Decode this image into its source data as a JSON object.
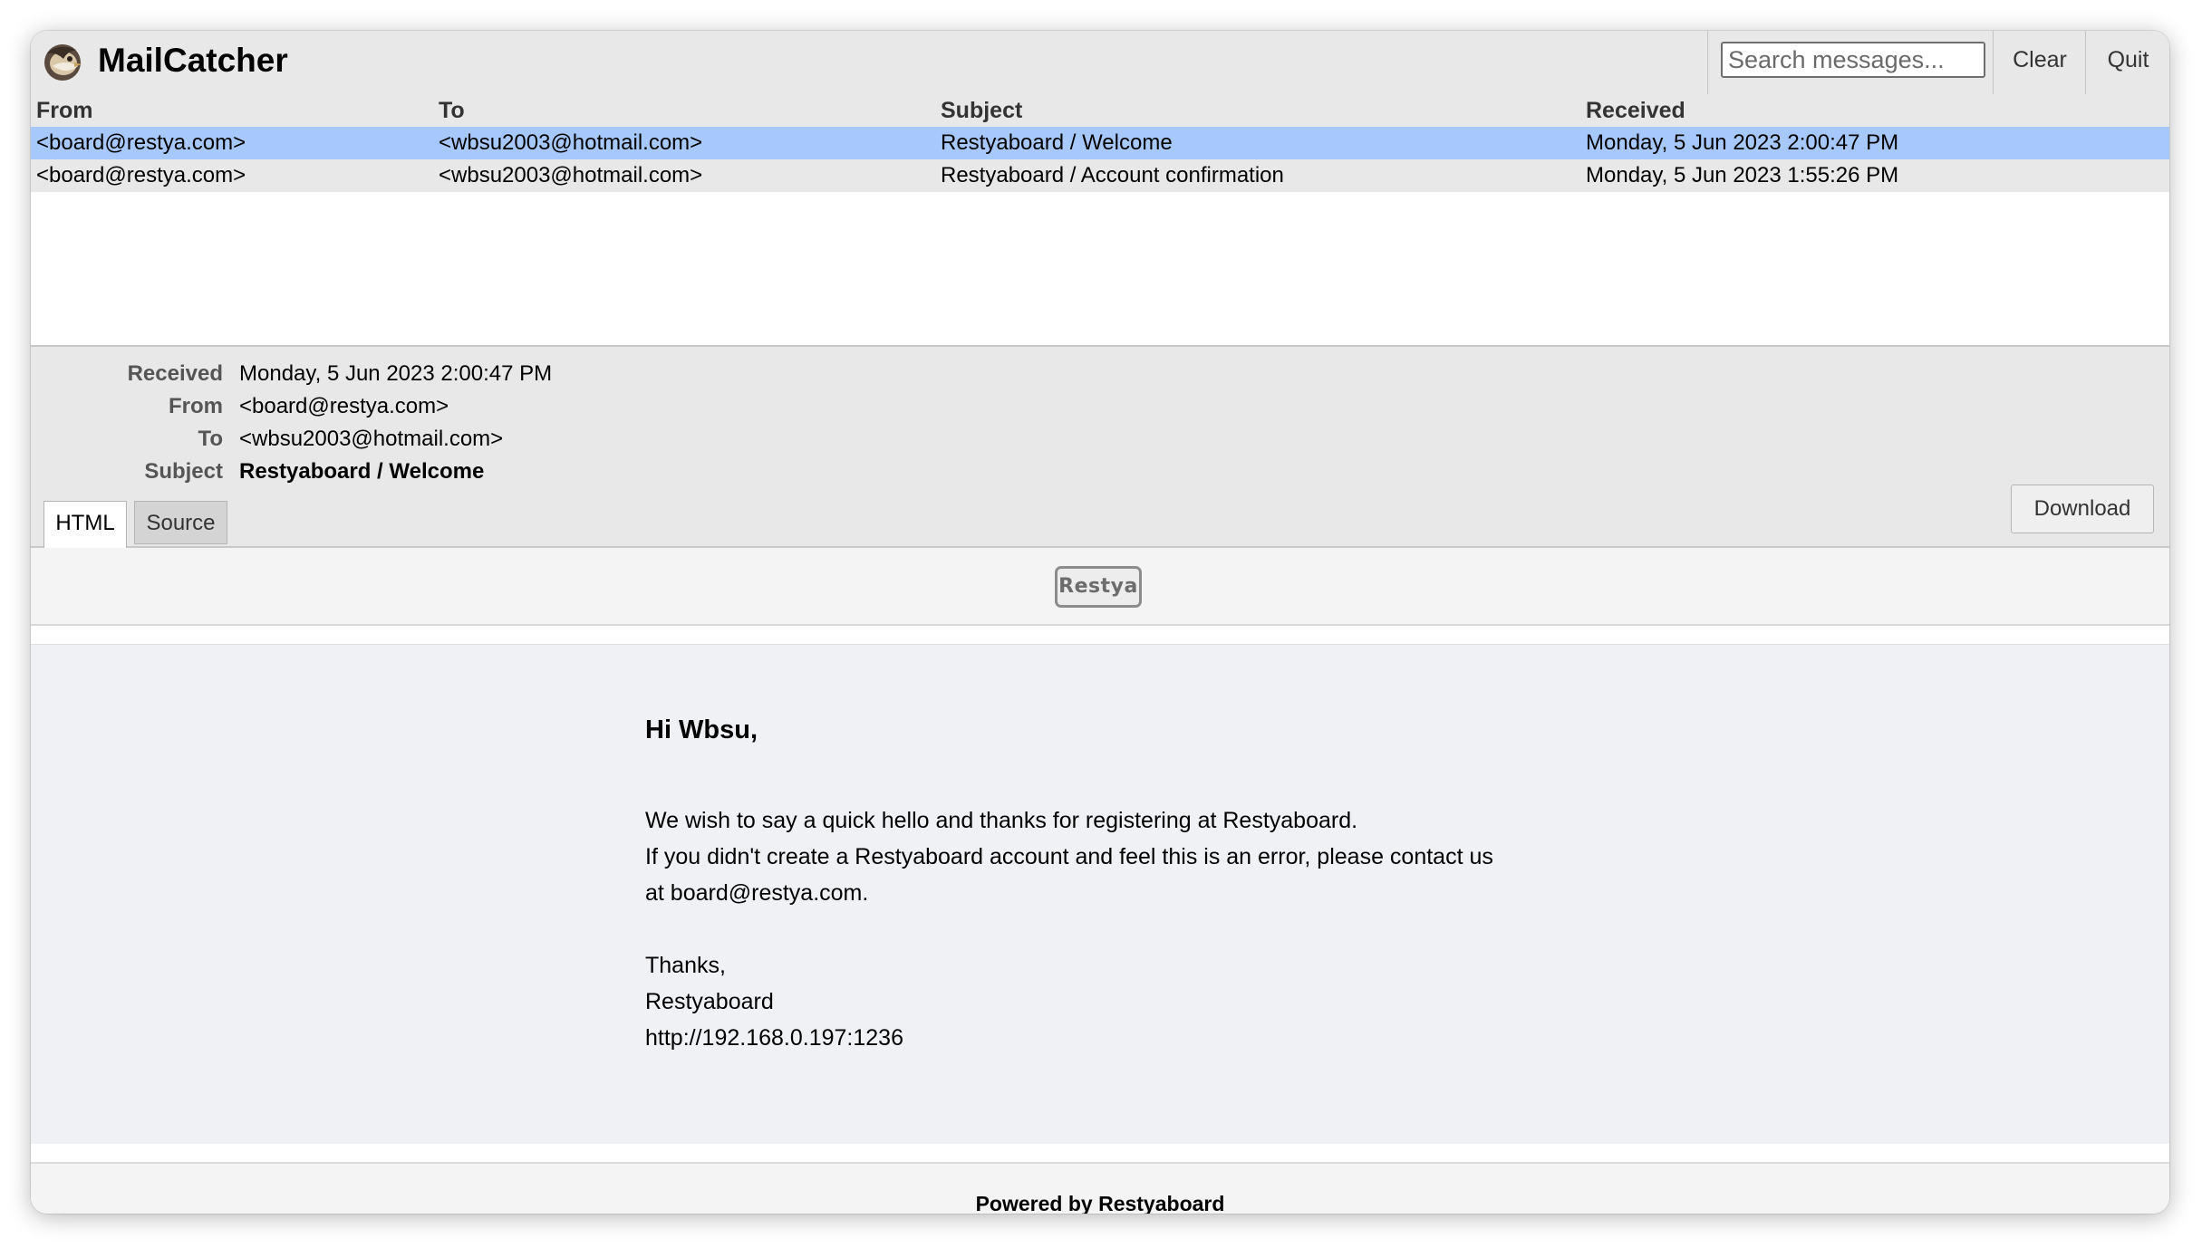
{
  "header": {
    "title": "MailCatcher",
    "search_placeholder": "Search messages...",
    "clear_label": "Clear",
    "quit_label": "Quit"
  },
  "list": {
    "columns": [
      "From",
      "To",
      "Subject",
      "Received"
    ],
    "rows": [
      {
        "from": "<board@restya.com>",
        "to": "<wbsu2003@hotmail.com>",
        "subject": "Restyaboard / Welcome",
        "received": "Monday, 5 Jun 2023 2:00:47 PM",
        "selected": true
      },
      {
        "from": "<board@restya.com>",
        "to": "<wbsu2003@hotmail.com>",
        "subject": "Restyaboard / Account confirmation",
        "received": "Monday, 5 Jun 2023 1:55:26 PM",
        "selected": false
      }
    ]
  },
  "meta": {
    "received_label": "Received",
    "received_value": "Monday, 5 Jun 2023 2:00:47 PM",
    "from_label": "From",
    "from_value": "<board@restya.com>",
    "to_label": "To",
    "to_value": "<wbsu2003@hotmail.com>",
    "subject_label": "Subject",
    "subject_value": "Restyaboard / Welcome",
    "tabs": [
      "HTML",
      "Source"
    ],
    "active_tab": "HTML",
    "download_label": "Download"
  },
  "email": {
    "logo_text": "Restya",
    "greeting": "Hi Wbsu,",
    "lines": [
      "We wish to say a quick hello and thanks for registering at Restyaboard.",
      "If you didn't create a Restyaboard account and feel this is an error, please contact us",
      "at board@restya.com."
    ],
    "signoff": [
      "Thanks,",
      "Restyaboard",
      "http://192.168.0.197:1236"
    ],
    "footer": "Powered by Restyaboard"
  },
  "colors": {
    "selected_row": "#a7c8fb",
    "header_bg": "#e8e8e8",
    "email_bg": "#f0f1f5"
  }
}
